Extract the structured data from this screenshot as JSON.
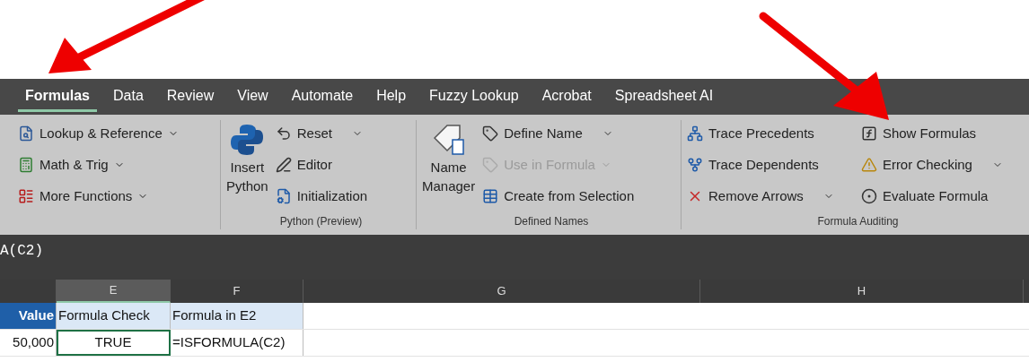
{
  "tabs": [
    {
      "label": "Formulas",
      "selected": true
    },
    {
      "label": "Data",
      "selected": false
    },
    {
      "label": "Review",
      "selected": false
    },
    {
      "label": "View",
      "selected": false
    },
    {
      "label": "Automate",
      "selected": false
    },
    {
      "label": "Help",
      "selected": false
    },
    {
      "label": "Fuzzy Lookup",
      "selected": false
    },
    {
      "label": "Acrobat",
      "selected": false
    },
    {
      "label": "Spreadsheet AI",
      "selected": false
    }
  ],
  "ribbon": {
    "groups": [
      {
        "columns": [
          [
            {
              "label": "Lookup & Reference",
              "kind": "menu",
              "disabled": false
            },
            {
              "label": "Math & Trig",
              "kind": "menu",
              "disabled": false
            },
            {
              "label": "More Functions",
              "kind": "menu",
              "disabled": false
            }
          ]
        ]
      },
      {
        "label": "Python (Preview)",
        "large": [
          {
            "lines": [
              "Insert",
              "Python"
            ]
          }
        ],
        "columns": [
          [
            {
              "label": "Reset",
              "kind": "split",
              "disabled": false
            },
            {
              "label": "Editor",
              "kind": "plain",
              "disabled": false
            },
            {
              "label": "Initialization",
              "kind": "plain",
              "disabled": false
            }
          ]
        ]
      },
      {
        "label": "Defined Names",
        "large": [
          {
            "lines": [
              "Name",
              "Manager"
            ]
          }
        ],
        "columns": [
          [
            {
              "label": "Define Name",
              "kind": "split",
              "disabled": false
            },
            {
              "label": "Use in Formula",
              "kind": "menu",
              "disabled": true
            },
            {
              "label": "Create from Selection",
              "kind": "plain",
              "disabled": false
            }
          ]
        ]
      },
      {
        "label": "Formula Auditing",
        "columns": [
          [
            {
              "label": "Trace Precedents",
              "kind": "plain",
              "disabled": false
            },
            {
              "label": "Trace Dependents",
              "kind": "plain",
              "disabled": false
            },
            {
              "label": "Remove Arrows",
              "kind": "split",
              "disabled": false
            }
          ],
          [
            {
              "label": "Show Formulas",
              "kind": "plain",
              "disabled": false
            },
            {
              "label": "Error Checking",
              "kind": "split",
              "disabled": false
            },
            {
              "label": "Evaluate Formula",
              "kind": "plain",
              "disabled": false
            }
          ]
        ]
      }
    ]
  },
  "formula_bar": {
    "text": "A(C2)"
  },
  "sheet": {
    "columns": [
      {
        "selected": false
      },
      {
        "label": "E",
        "selected": true
      },
      {
        "label": "F",
        "selected": false
      },
      {
        "label": "G",
        "selected": false
      },
      {
        "label": "H",
        "selected": false
      }
    ],
    "rows": [
      [
        {
          "text": "Value",
          "kind": "dark_header",
          "selected": false
        },
        {
          "text": "Formula Check",
          "kind": "light_header",
          "selected": false
        },
        {
          "text": "Formula in E2",
          "kind": "light_header",
          "selected": false
        }
      ],
      [
        {
          "text": "50,000",
          "kind": "number",
          "selected": false
        },
        {
          "text": "TRUE",
          "kind": "center",
          "selected": true
        },
        {
          "text": "=ISFORMULA(C2)",
          "kind": "text",
          "selected": false
        }
      ]
    ]
  }
}
